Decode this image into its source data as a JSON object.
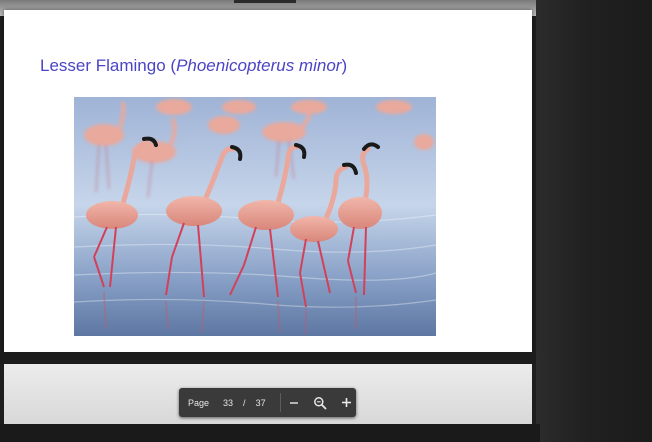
{
  "slide": {
    "title_common": "Lesser Flamingo (",
    "title_scientific": "Phoenicopterus minor",
    "title_close": ")"
  },
  "photo": {
    "subject": "flamingo-photo",
    "colors": {
      "water_light": "#c9d8ec",
      "water_mid": "#7f99c2",
      "water_dark": "#4e6896",
      "flamingo_body": "#eaa79c",
      "flamingo_shadow": "#d98378",
      "leg": "#d2405a",
      "beak_tip": "#1a1a1a"
    }
  },
  "toolbar": {
    "page_label": "Page",
    "current_page": "33",
    "separator": "/",
    "total_pages": "37",
    "zoom_out_icon": "minus-icon",
    "zoom_reset_icon": "magnifier-icon",
    "zoom_in_icon": "plus-icon"
  },
  "theme": {
    "title_color": "#4a45c4",
    "viewer_background": "#202020",
    "toolbar_background": "#3a3a3a"
  }
}
